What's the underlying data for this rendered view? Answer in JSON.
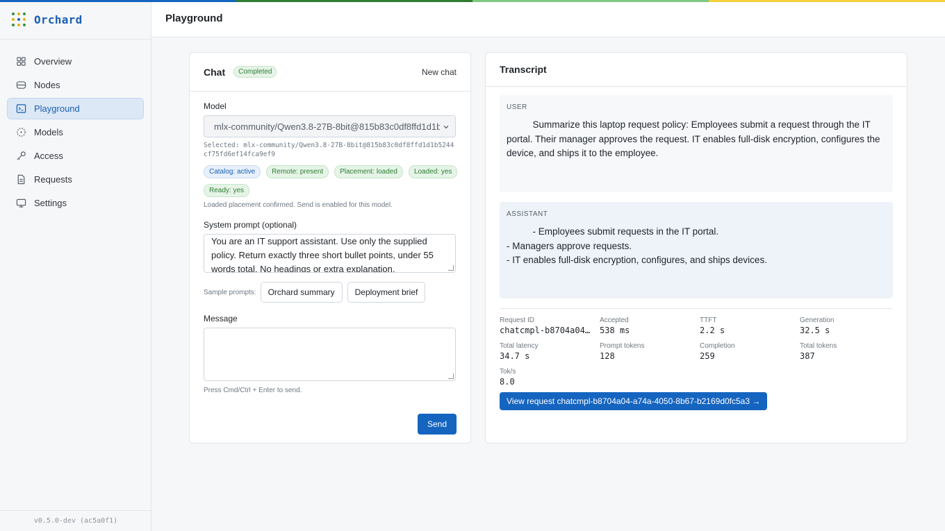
{
  "brand": {
    "name": "Orchard",
    "version": "v0.5.0-dev (ac5a0f1)"
  },
  "colors": {
    "accent": "#1565c0",
    "stripe": [
      "#1565c0",
      "#2e7d32",
      "#81c784",
      "#f4d03f"
    ]
  },
  "sidebar": {
    "items": [
      {
        "label": "Overview",
        "icon": "grid-icon"
      },
      {
        "label": "Nodes",
        "icon": "database-icon"
      },
      {
        "label": "Playground",
        "icon": "terminal-icon",
        "active": true
      },
      {
        "label": "Models",
        "icon": "models-icon"
      },
      {
        "label": "Access",
        "icon": "key-icon"
      },
      {
        "label": "Requests",
        "icon": "document-icon"
      },
      {
        "label": "Settings",
        "icon": "monitor-icon"
      }
    ]
  },
  "header": {
    "title": "Playground"
  },
  "chat": {
    "title": "Chat",
    "status": "Completed",
    "new_chat": "New chat",
    "model_label": "Model",
    "model_value": "mlx-community/Qwen3.8-27B-8bit@815b83c0df8ffd1d1b5244cf75fd6ef14fca9ef9",
    "selected_text": "Selected: mlx-community/Qwen3.8-27B-8bit@815b83c0df8ffd1d1b5244cf75fd6ef14fca9ef9",
    "badges": [
      {
        "label": "Catalog: active",
        "tone": "blue"
      },
      {
        "label": "Remote: present",
        "tone": "green"
      },
      {
        "label": "Placement: loaded",
        "tone": "green"
      },
      {
        "label": "Loaded: yes",
        "tone": "green"
      },
      {
        "label": "Ready: yes",
        "tone": "green"
      }
    ],
    "placement_note": "Loaded placement confirmed. Send is enabled for this model.",
    "system_label": "System prompt (optional)",
    "system_value": "You are an IT support assistant. Use only the supplied policy. Return exactly three short bullet points, under 55 words total. No headings or extra explanation.",
    "samples_label": "Sample prompts:",
    "samples": [
      "Orchard summary",
      "Deployment brief"
    ],
    "message_label": "Message",
    "message_value": "",
    "hint": "Press Cmd/Ctrl + Enter to send.",
    "send_label": "Send"
  },
  "transcript": {
    "title": "Transcript",
    "messages": [
      {
        "role": "USER",
        "text": "          Summarize this laptop request policy: Employees submit a request through the IT portal. Their manager approves the request. IT enables full-disk encryption, configures the device, and ships it to the employee."
      },
      {
        "role": "ASSISTANT",
        "text": "          - Employees submit requests in the IT portal.\n- Managers approve requests.\n- IT enables full-disk encryption, configures, and ships devices."
      }
    ],
    "stats": [
      {
        "label": "Request ID",
        "value": "chatcmpl-b8704a04-a74a-4050-8b67-b2169d0fc5a3"
      },
      {
        "label": "Accepted",
        "value": "538 ms"
      },
      {
        "label": "TTFT",
        "value": "2.2 s"
      },
      {
        "label": "Generation",
        "value": "32.5 s"
      },
      {
        "label": "Total latency",
        "value": "34.7 s"
      },
      {
        "label": "Prompt tokens",
        "value": "128"
      },
      {
        "label": "Completion",
        "value": "259"
      },
      {
        "label": "Total tokens",
        "value": "387"
      },
      {
        "label": "Tok/s",
        "value": "8.0"
      }
    ],
    "view_button": "View request chatcmpl-b8704a04-a74a-4050-8b67-b2169d0fc5a3 →"
  }
}
